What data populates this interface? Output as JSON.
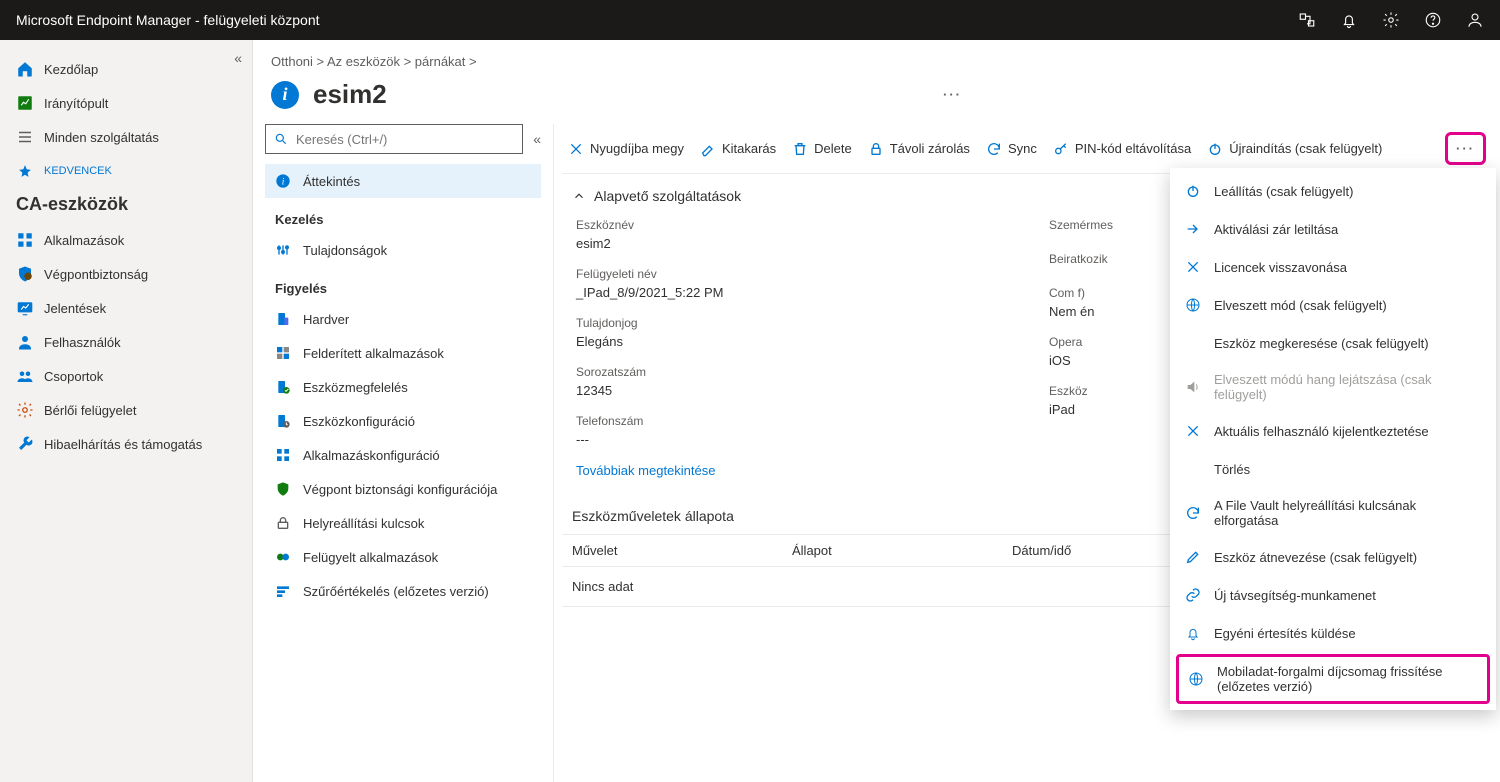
{
  "app": {
    "title": "Microsoft Endpoint Manager - felügyeleti központ"
  },
  "sidebar": {
    "items": [
      {
        "label": "Kezdőlap"
      },
      {
        "label": "Irányítópult"
      },
      {
        "label": "Minden szolgáltatás"
      }
    ],
    "favorites_label": "KEDVENCEK",
    "group_heading": "CA-eszközök",
    "fav_items": [
      {
        "label": "Alkalmazások"
      },
      {
        "label": "Végpontbiztonság"
      },
      {
        "label": "Jelentések"
      },
      {
        "label": "Felhasználók"
      },
      {
        "label": "Csoportok"
      },
      {
        "label": "Bérlői felügyelet"
      },
      {
        "label": "Hibaelhárítás és támogatás"
      }
    ]
  },
  "breadcrumb": "Otthoni >  Az eszközök >  párnákat >",
  "page": {
    "title": "esim2"
  },
  "search": {
    "placeholder": "Keresés (Ctrl+/)"
  },
  "inner_nav": {
    "overview": "Áttekintés",
    "manage_label": "Kezelés",
    "manage_items": [
      {
        "label": "Tulajdonságok"
      }
    ],
    "monitor_label": "Figyelés",
    "monitor_items": [
      {
        "label": "Hardver"
      },
      {
        "label": "Felderített alkalmazások"
      },
      {
        "label": "Eszközmegfelelés"
      },
      {
        "label": "Eszközkonfiguráció"
      },
      {
        "label": "Alkalmazáskonfiguráció"
      },
      {
        "label": "Végpont biztonsági konfigurációja"
      },
      {
        "label": "Helyreállítási kulcsok"
      },
      {
        "label": "Felügyelt alkalmazások"
      },
      {
        "label": "Szűrőértékelés (előzetes verzió)"
      }
    ]
  },
  "commands": {
    "retire": "Nyugdíjba megy",
    "wipe": "Kitakarás",
    "delete": "Delete",
    "remote_lock": "Távoli zárolás",
    "sync": "Sync",
    "remove_pin": "PIN-kód eltávolítása",
    "restart": "Újraindítás (csak felügyelt)"
  },
  "essentials": {
    "header": "Alapvető szolgáltatások",
    "left": [
      {
        "label": "Eszköznév",
        "value": "esim2"
      },
      {
        "label": "Felügyeleti név",
        "value": "_IPad_8/9/2021_5:22 PM"
      },
      {
        "label": "Tulajdonjog",
        "value": "Elegáns"
      },
      {
        "label": "Sorozatszám",
        "value": "12345"
      },
      {
        "label": "Telefonszám",
        "value": "---"
      }
    ],
    "right": [
      {
        "label": "Szemérmes",
        "value": ""
      },
      {
        "label": "Beiratkozik",
        "value": ""
      },
      {
        "label": "Com f)",
        "value": "Nem én"
      },
      {
        "label": "Opera",
        "value": "iOS"
      },
      {
        "label": "Eszköz",
        "value": "iPad"
      }
    ],
    "see_more": "Továbbiak megtekintése"
  },
  "actions_status": {
    "title": "Eszközműveletek állapota",
    "cols": [
      "Művelet",
      "Állapot",
      "Dátum/idő"
    ],
    "no_data": "Nincs adat"
  },
  "dropdown": {
    "items": [
      {
        "label": "Leállítás (csak felügyelt)",
        "disabled": false,
        "icon": "power"
      },
      {
        "label": "Aktiválási zár letiltása",
        "disabled": false,
        "icon": "arrow"
      },
      {
        "label": "Licencek visszavonása",
        "disabled": false,
        "icon": "x"
      },
      {
        "label": "Elveszett mód (csak felügyelt)",
        "disabled": false,
        "icon": "globe"
      },
      {
        "label": "Eszköz megkeresése (csak felügyelt)",
        "disabled": false,
        "icon": "blank"
      },
      {
        "label": "Elveszett módú hang lejátszása (csak felügyelt)",
        "disabled": true,
        "icon": "sound"
      },
      {
        "label": "Aktuális felhasználó kijelentkeztetése",
        "disabled": false,
        "icon": "x"
      },
      {
        "label": "Törlés",
        "disabled": false,
        "icon": "blank"
      },
      {
        "label": "A File Vault helyreállítási kulcsának elforgatása",
        "disabled": false,
        "icon": "refresh"
      },
      {
        "label": "Eszköz átnevezése (csak felügyelt)",
        "disabled": false,
        "icon": "pencil"
      },
      {
        "label": "Új távsegítség-munkamenet",
        "disabled": false,
        "icon": "link"
      },
      {
        "label": "Egyéni értesítés küldése",
        "disabled": false,
        "icon": "bell"
      },
      {
        "label": "Mobiladat-forgalmi díjcsomag frissítése (előzetes verzió)",
        "disabled": false,
        "icon": "globe",
        "highlight": true
      }
    ]
  },
  "colors": {
    "primary": "#0078d4",
    "highlight": "#e3008c"
  }
}
